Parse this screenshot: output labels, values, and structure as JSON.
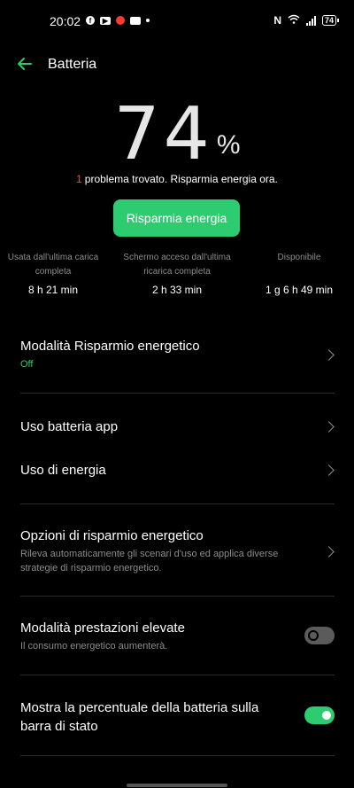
{
  "status_bar": {
    "time": "20:02",
    "battery_level": "74",
    "network_indicator": "N"
  },
  "header": {
    "title": "Batteria",
    "back_icon": "arrow-left-icon"
  },
  "battery": {
    "percent_value": "74",
    "percent_unit": "%",
    "problem_count": "1",
    "problem_text": "problema trovato. Risparmia energia ora.",
    "save_button_label": "Risparmia energia"
  },
  "stats": [
    {
      "label": "Usata dall'ultima carica completa",
      "value": "8 h 21 min"
    },
    {
      "label": "Schermo acceso dall'ultima ricarica completa",
      "value": "2 h 33 min"
    },
    {
      "label": "Disponibile",
      "value": "1 g 6 h 49 min"
    }
  ],
  "settings": {
    "power_saving_mode": {
      "title": "Modalità Risparmio energetico",
      "status": "Off"
    },
    "app_battery_usage": {
      "title": "Uso batteria app"
    },
    "energy_usage": {
      "title": "Uso di energia"
    },
    "power_saving_options": {
      "title": "Opzioni di risparmio energetico",
      "subtitle": "Rileva automaticamente gli scenari d'uso ed applica diverse strategie di risparmio energetico."
    },
    "high_performance_mode": {
      "title": "Modalità prestazioni elevate",
      "subtitle": "Il consumo energetico aumenterà.",
      "enabled": false
    },
    "show_battery_percentage": {
      "title": "Mostra la percentuale della batteria sulla barra di stato",
      "enabled": true
    }
  },
  "colors": {
    "accent": "#2ecc71",
    "warning": "#ff453a",
    "background": "#000000"
  }
}
